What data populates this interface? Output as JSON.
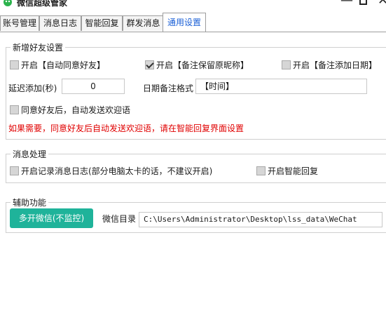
{
  "window": {
    "title": "微信超级管家",
    "minimize_glyph": "—",
    "close_glyph": "✕"
  },
  "tabs": [
    {
      "label": "账号管理",
      "active": false
    },
    {
      "label": "消息日志",
      "active": false
    },
    {
      "label": "智能回复",
      "active": false
    },
    {
      "label": "群发消息",
      "active": false
    },
    {
      "label": "通用设置",
      "active": true
    }
  ],
  "new_friend": {
    "legend": "新增好友设置",
    "auto_accept": {
      "label": "开启【自动同意好友】",
      "checked": false
    },
    "keep_remark": {
      "label": "开启【备注保留原昵称】",
      "checked": true
    },
    "add_date_remark": {
      "label": "开启【备注添加日期】",
      "checked": false
    },
    "delay_label": "延迟添加(秒)",
    "delay_value": "0",
    "date_format_label": "日期备注格式",
    "date_format_value": "【时间】",
    "welcome": {
      "label": "同意好友后，自动发送欢迎语",
      "checked": false
    },
    "hint": "如果需要，同意好友后自动发送欢迎语，请在智能回复界面设置"
  },
  "message": {
    "legend": "消息处理",
    "log": {
      "label": "开启记录消息日志(部分电脑太卡的话，不建议开启)",
      "checked": false
    },
    "smart_reply": {
      "label": "开启智能回复",
      "checked": false
    }
  },
  "aux": {
    "legend": "辅助功能",
    "multi_button": "多开微信(不监控)",
    "dir_label": "微信目录",
    "dir_value": "C:\\Users\\Administrator\\Desktop\\lss_data\\WeChat"
  },
  "colors": {
    "accent_tab": "#1a5fd6",
    "warning": "#e00000",
    "button_green": "#1fb39a"
  }
}
